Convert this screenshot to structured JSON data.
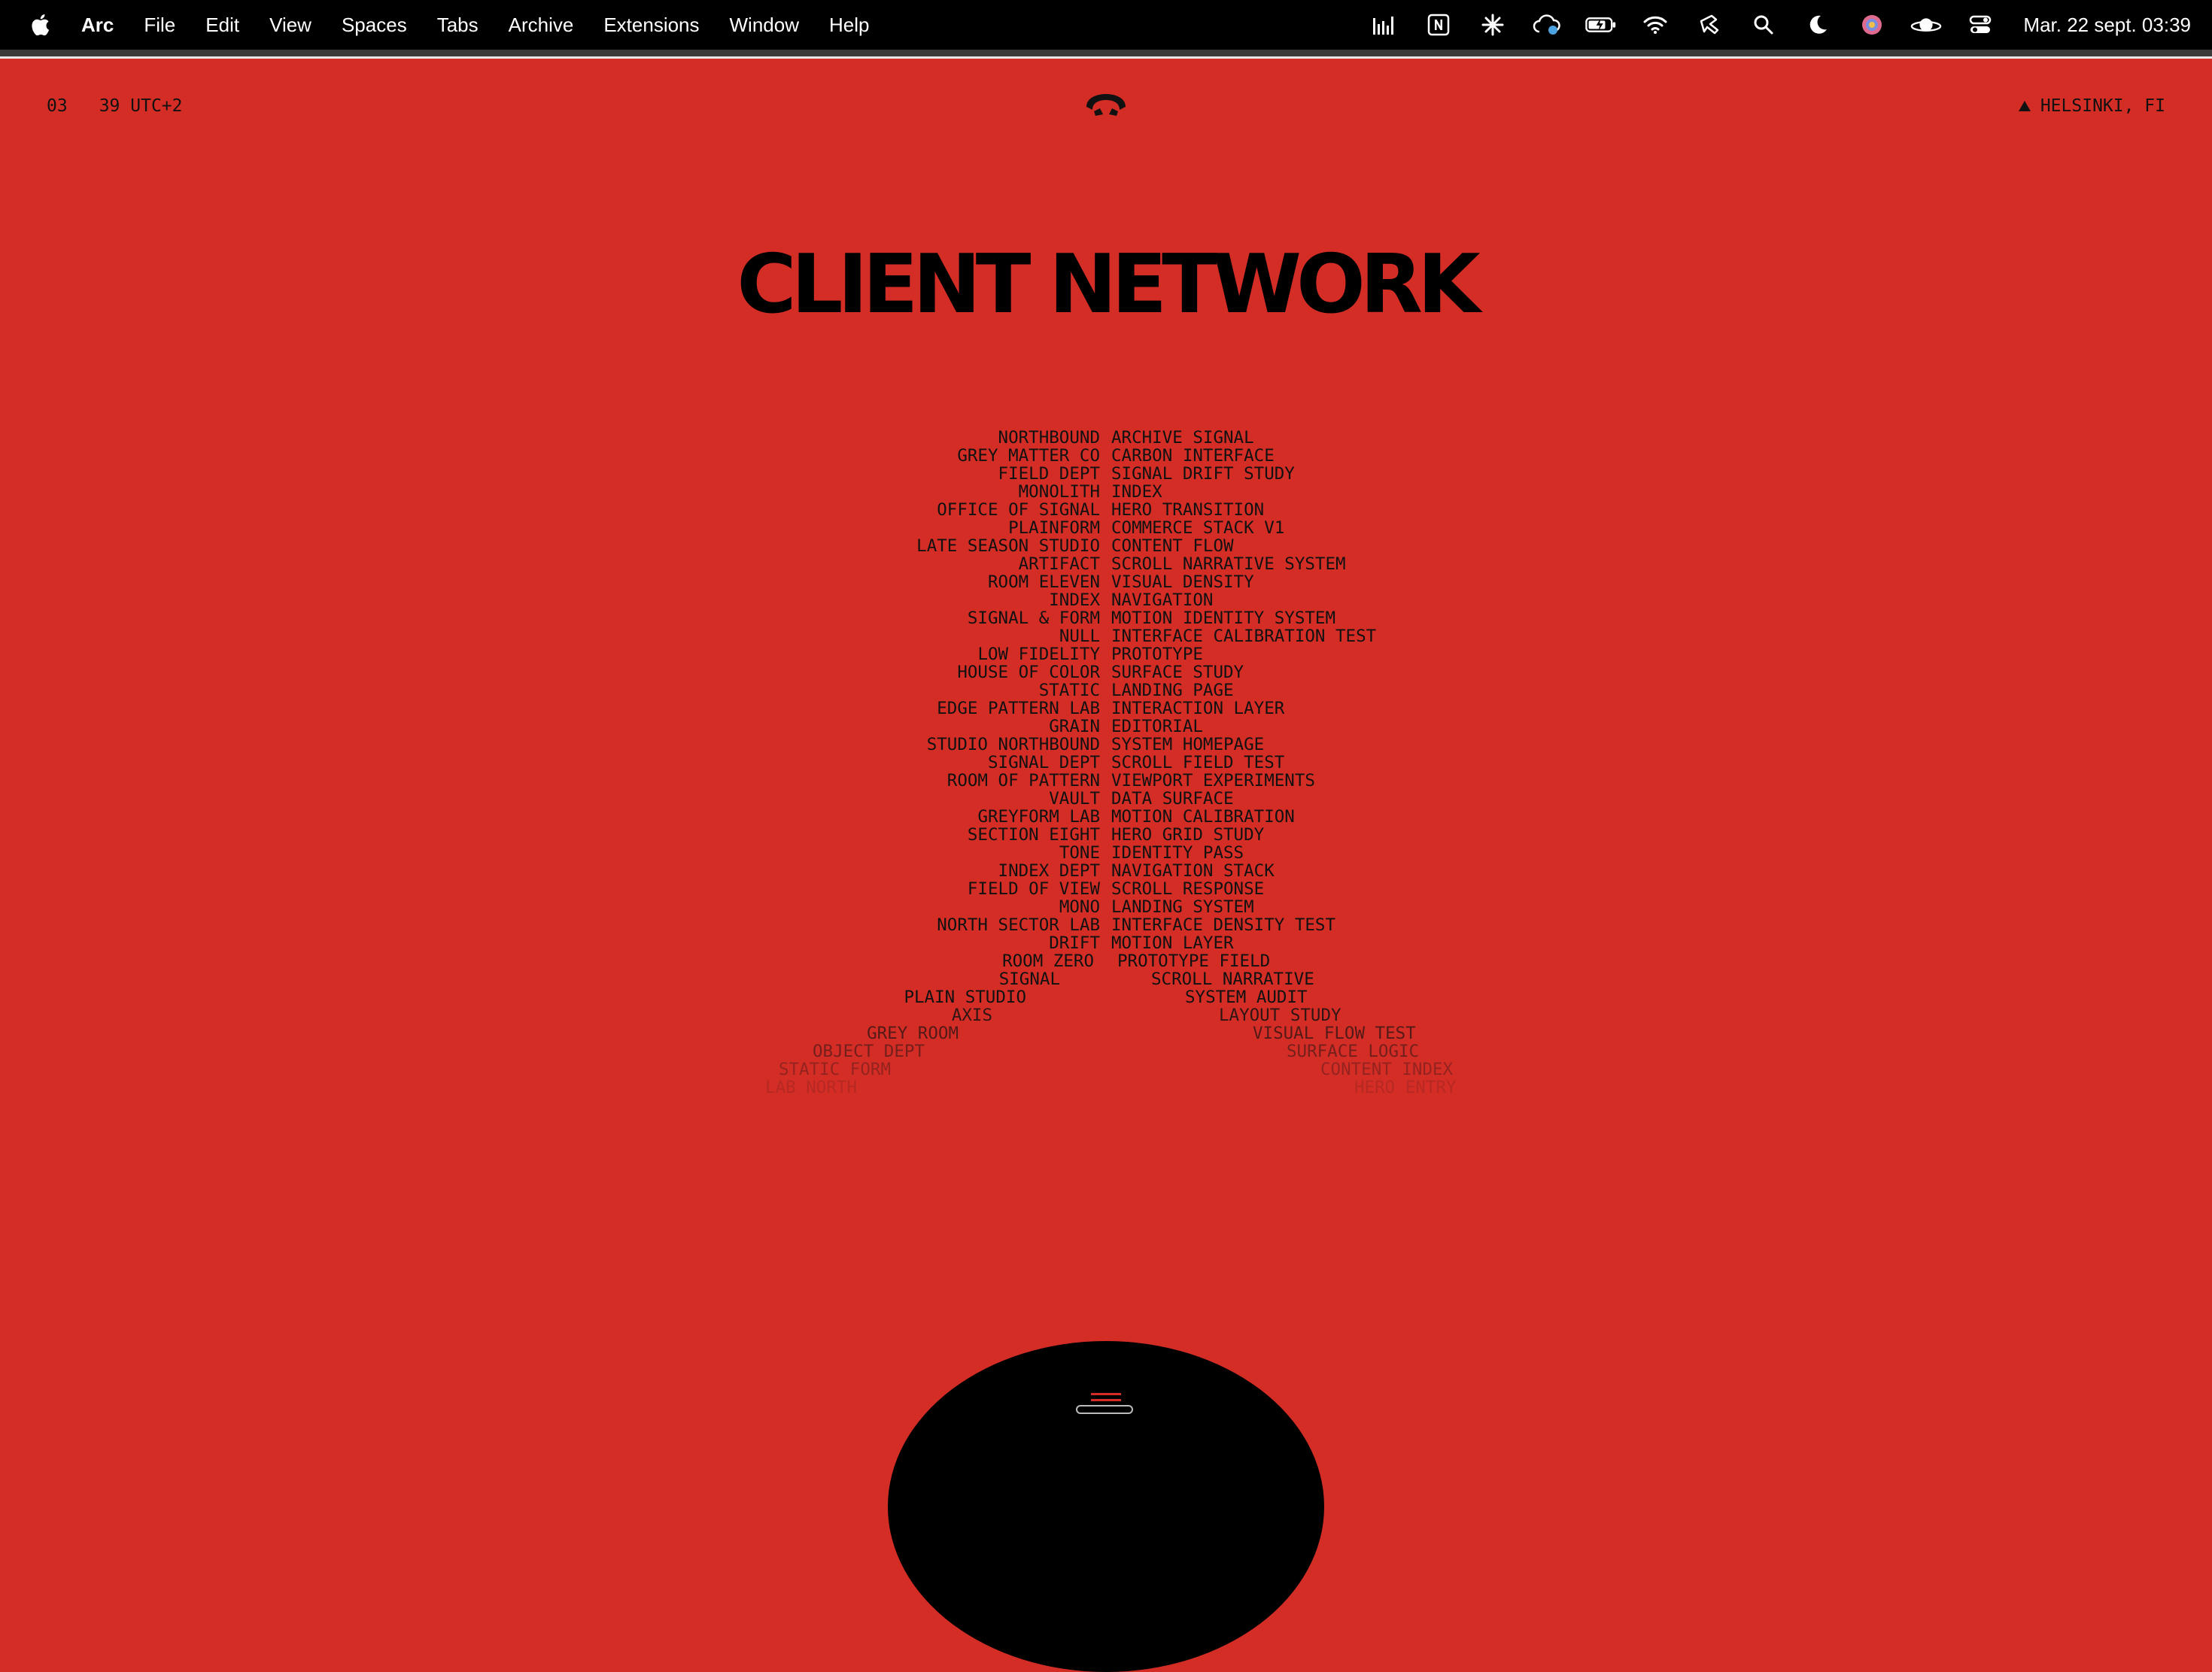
{
  "menubar": {
    "app_name": "Arc",
    "items": [
      "File",
      "Edit",
      "View",
      "Spaces",
      "Tabs",
      "Archive",
      "Extensions",
      "Window",
      "Help"
    ],
    "status_icons": [
      "audio-levels-icon",
      "notion-icon",
      "sparkle-icon",
      "cloud-sync-icon",
      "battery-icon",
      "wifi-icon",
      "hand-pointer-icon",
      "search-icon",
      "moon-icon",
      "user-avatar-icon",
      "planet-icon",
      "control-center-icon"
    ],
    "clock": "Mar. 22 sept. 03:39"
  },
  "header": {
    "hour": "03",
    "minute_zone": "39 UTC+2",
    "location": "HELSINKI, FI"
  },
  "title": "CLIENT NETWORK",
  "clients": [
    {
      "name": "NORTHBOUND",
      "project": "ARCHIVE SIGNAL"
    },
    {
      "name": "GREY MATTER CO",
      "project": "CARBON INTERFACE"
    },
    {
      "name": "FIELD DEPT",
      "project": "SIGNAL DRIFT STUDY"
    },
    {
      "name": "MONOLITH",
      "project": "INDEX"
    },
    {
      "name": "OFFICE OF SIGNAL",
      "project": "HERO TRANSITION"
    },
    {
      "name": "PLAINFORM",
      "project": "COMMERCE STACK V1"
    },
    {
      "name": "LATE SEASON STUDIO",
      "project": "CONTENT FLOW"
    },
    {
      "name": "ARTIFACT",
      "project": "SCROLL NARRATIVE SYSTEM"
    },
    {
      "name": "ROOM ELEVEN",
      "project": "VISUAL DENSITY"
    },
    {
      "name": "INDEX",
      "project": "NAVIGATION"
    },
    {
      "name": "SIGNAL & FORM",
      "project": "MOTION IDENTITY SYSTEM"
    },
    {
      "name": "NULL",
      "project": "INTERFACE CALIBRATION TEST"
    },
    {
      "name": "LOW FIDELITY",
      "project": "PROTOTYPE"
    },
    {
      "name": "HOUSE OF COLOR",
      "project": "SURFACE STUDY"
    },
    {
      "name": "STATIC",
      "project": "LANDING PAGE"
    },
    {
      "name": "EDGE PATTERN LAB",
      "project": "INTERACTION LAYER"
    },
    {
      "name": "GRAIN",
      "project": "EDITORIAL"
    },
    {
      "name": "STUDIO NORTHBOUND",
      "project": "SYSTEM HOMEPAGE"
    },
    {
      "name": "SIGNAL DEPT",
      "project": "SCROLL FIELD TEST"
    },
    {
      "name": "ROOM OF PATTERN",
      "project": "VIEWPORT EXPERIMENTS"
    },
    {
      "name": "VAULT",
      "project": "DATA SURFACE"
    },
    {
      "name": "GREYFORM LAB",
      "project": "MOTION CALIBRATION"
    },
    {
      "name": "SECTION EIGHT",
      "project": "HERO GRID STUDY"
    },
    {
      "name": "TONE",
      "project": "IDENTITY PASS"
    },
    {
      "name": "INDEX DEPT",
      "project": "NAVIGATION STACK"
    },
    {
      "name": "FIELD OF VIEW",
      "project": "SCROLL RESPONSE"
    },
    {
      "name": "MONO",
      "project": "LANDING SYSTEM"
    },
    {
      "name": "NORTH SECTOR LAB",
      "project": "INTERFACE DENSITY TEST"
    },
    {
      "name": "DRIFT",
      "project": "MOTION LAYER"
    },
    {
      "name": "ROOM ZERO",
      "project": "PROTOTYPE FIELD"
    },
    {
      "name": "SIGNAL",
      "project": "SCROLL NARRATIVE"
    },
    {
      "name": "PLAIN STUDIO",
      "project": "SYSTEM AUDIT"
    },
    {
      "name": "AXIS",
      "project": "LAYOUT STUDY"
    },
    {
      "name": "GREY ROOM",
      "project": "VISUAL FLOW TEST"
    },
    {
      "name": "OBJECT DEPT",
      "project": "SURFACE LOGIC"
    },
    {
      "name": "STATIC FORM",
      "project": "CONTENT INDEX"
    },
    {
      "name": "LAB NORTH",
      "project": "HERO ENTRY"
    }
  ],
  "colors": {
    "background": "#d42d26",
    "ink": "#111111"
  }
}
